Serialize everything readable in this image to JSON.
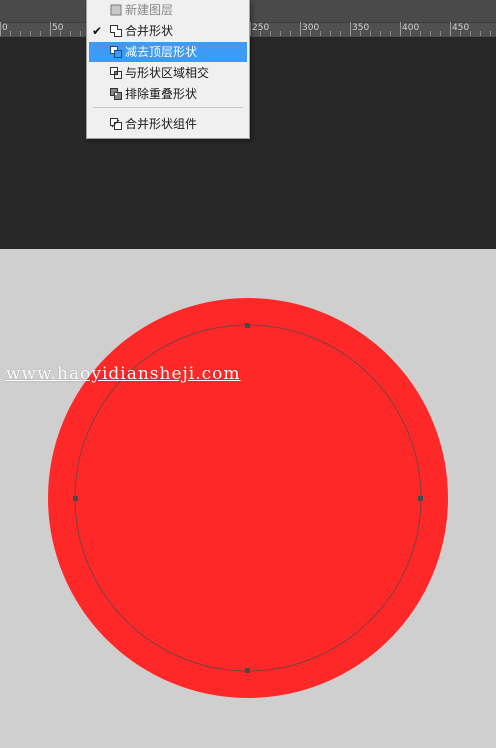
{
  "ruler": {
    "labels": [
      "0",
      "50",
      "250",
      "300",
      "350",
      "400",
      "450"
    ]
  },
  "menu": {
    "items": [
      {
        "label": "新建图层",
        "state": "disabled",
        "icon": "new-layer-icon"
      },
      {
        "label": "合并形状",
        "state": "checked",
        "icon": "combine-shapes-icon"
      },
      {
        "label": "减去顶层形状",
        "state": "highlighted",
        "icon": "subtract-front-shape-icon"
      },
      {
        "label": "与形状区域相交",
        "state": "normal",
        "icon": "intersect-shape-areas-icon"
      },
      {
        "label": "排除重叠形状",
        "state": "normal",
        "icon": "exclude-overlapping-shapes-icon"
      },
      {
        "label": "合并形状组件",
        "state": "normal",
        "icon": "merge-shape-components-icon"
      }
    ],
    "check_glyph": "✔"
  },
  "canvas": {
    "watermark": "www.haoyidiansheji.com",
    "shape_color": "#ff2828",
    "canvas_color": "#cfcfcf",
    "highlight_color": "#3e9bf5"
  }
}
